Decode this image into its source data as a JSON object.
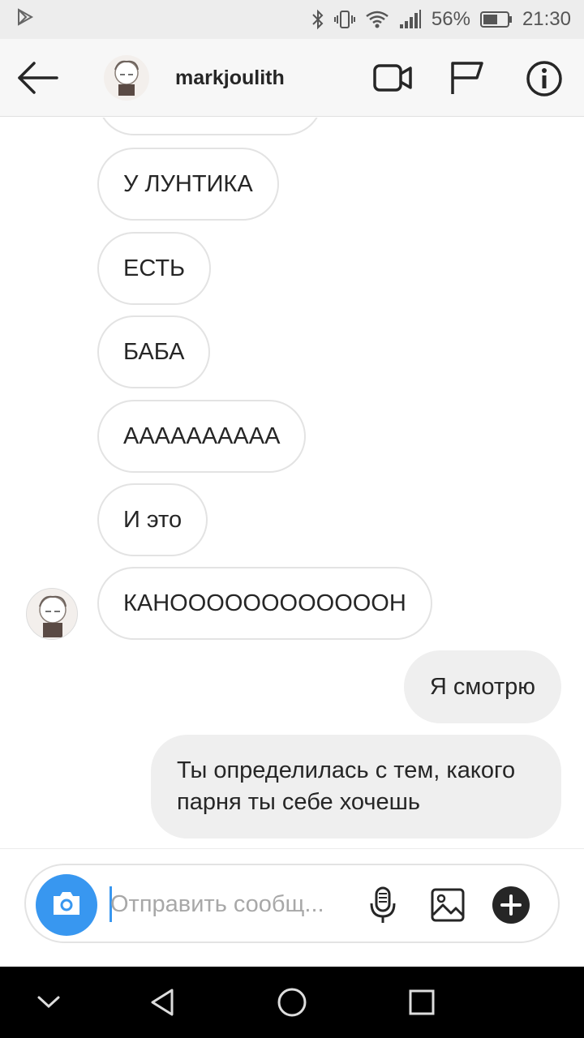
{
  "status_bar": {
    "battery_percent": "56%",
    "time": "21:30",
    "icons": [
      "play-store-icon",
      "bluetooth-icon",
      "vibrate-icon",
      "wifi-icon",
      "signal-icon",
      "battery-icon"
    ]
  },
  "header": {
    "username": "markjoulith",
    "icons": [
      "back-arrow-icon",
      "video-call-icon",
      "flag-icon",
      "info-icon"
    ]
  },
  "messages": [
    {
      "sender": "them",
      "text": "У ЛУНТИКА"
    },
    {
      "sender": "them",
      "text": "ЕСТЬ"
    },
    {
      "sender": "them",
      "text": "БАБА"
    },
    {
      "sender": "them",
      "text": "АААААААААА"
    },
    {
      "sender": "them",
      "text": "И это"
    },
    {
      "sender": "them",
      "text": "КАНООООООООООООН"
    },
    {
      "sender": "me",
      "text": "Я смотрю"
    },
    {
      "sender": "me",
      "text": "Ты определилась с тем, какого парня ты себе хочешь"
    }
  ],
  "composer": {
    "placeholder": "Отправить сообщ...",
    "icons": [
      "camera-icon",
      "microphone-icon",
      "gallery-icon",
      "plus-icon"
    ]
  },
  "colors": {
    "accent": "#3897f0",
    "outgoing_bubble": "#efefef",
    "incoming_border": "#e3e3e3"
  }
}
